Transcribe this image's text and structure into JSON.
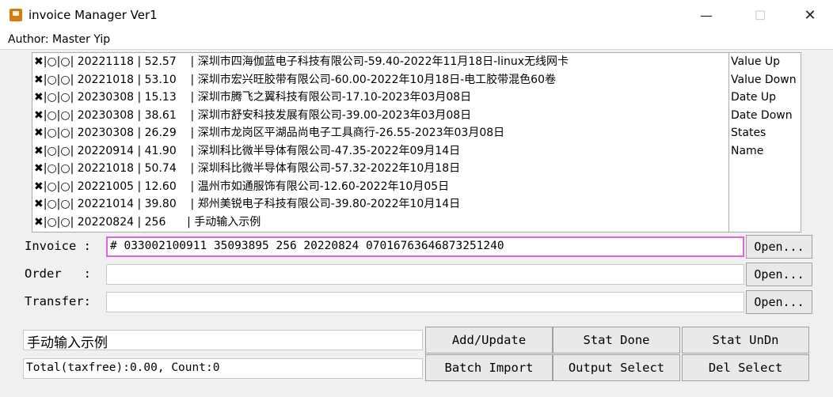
{
  "window": {
    "title": "invoice Manager Ver1",
    "min_glyph": "—",
    "max_glyph": "☐",
    "close_glyph": "✕"
  },
  "author": "Author: Master Yip",
  "invoices": [
    {
      "mark": "✖",
      "rest": "|○|○| 20221118 | 52.57    | 深圳市四海伽蓝电子科技有限公司-59.40-2022年11月18日-linux无线网卡"
    },
    {
      "mark": "✖",
      "rest": "|○|○| 20221018 | 53.10    | 深圳市宏兴旺胶带有限公司-60.00-2022年10月18日-电工胶带混色60卷"
    },
    {
      "mark": "✖",
      "rest": "|○|○| 20230308 | 15.13    | 深圳市腾飞之翼科技有限公司-17.10-2023年03月08日"
    },
    {
      "mark": "✖",
      "rest": "|○|○| 20230308 | 38.61    | 深圳市舒安科技发展有限公司-39.00-2023年03月08日"
    },
    {
      "mark": "✖",
      "rest": "|○|○| 20230308 | 26.29    | 深圳市龙岗区平湖品尚电子工具商行-26.55-2023年03月08日"
    },
    {
      "mark": "✖",
      "rest": "|○|○| 20220914 | 41.90    | 深圳科比微半导体有限公司-47.35-2022年09月14日"
    },
    {
      "mark": "✖",
      "rest": "|○|○| 20221018 | 50.74    | 深圳科比微半导体有限公司-57.32-2022年10月18日"
    },
    {
      "mark": "✖",
      "rest": "|○|○| 20221005 | 12.60    | 温州市如通服饰有限公司-12.60-2022年10月05日"
    },
    {
      "mark": "✖",
      "rest": "|○|○| 20221014 | 39.80    | 郑州美锐电子科技有限公司-39.80-2022年10月14日"
    },
    {
      "mark": "✖",
      "rest": "|○|○| 20220824 | 256      | 手动输入示例"
    }
  ],
  "sort_options": [
    "Value Up",
    "Value Down",
    "Date Up",
    "Date Down",
    "States",
    "Name"
  ],
  "fields": {
    "invoice_label": "Invoice :",
    "invoice_value": "# 033002100911 35093895 256 20220824 07016763646873251240",
    "order_label": "Order   :",
    "order_value": "",
    "transfer_label": "Transfer:",
    "transfer_value": "",
    "open_label": "Open..."
  },
  "memo_value": "手动输入示例",
  "status_text": "Total(taxfree):0.00, Count:0",
  "buttons": {
    "add_update": "Add/Update",
    "stat_done": "Stat Done",
    "stat_undn": "Stat UnDn",
    "batch_import": "Batch Import",
    "output_select": "Output Select",
    "del_select": "Del Select"
  }
}
